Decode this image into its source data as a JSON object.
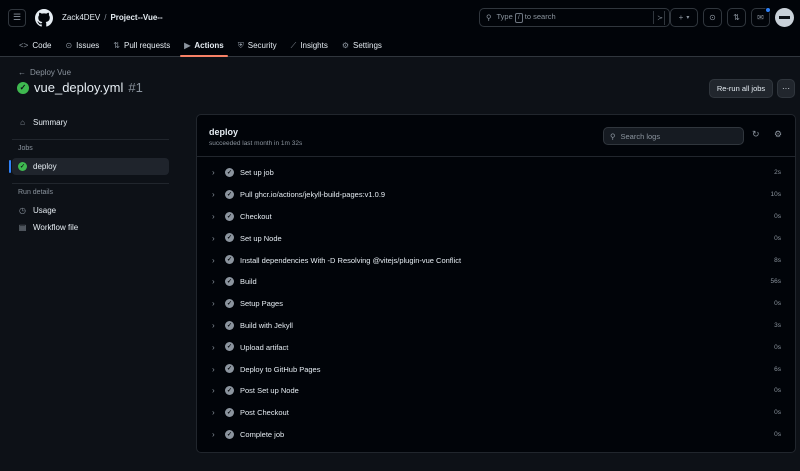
{
  "header": {
    "owner": "Zack4DEV",
    "separator": "/",
    "repo": "Project--Vue--",
    "search_pre": "Type",
    "search_key": "/",
    "search_post": "to search",
    "cmd_icon": "command-palette-icon"
  },
  "repo_nav": [
    {
      "label": "Code",
      "icon": "<>"
    },
    {
      "label": "Issues",
      "icon": "⊙"
    },
    {
      "label": "Pull requests",
      "icon": "⇅"
    },
    {
      "label": "Actions",
      "icon": "▶"
    },
    {
      "label": "Security",
      "icon": "⛨"
    },
    {
      "label": "Insights",
      "icon": "⟋"
    },
    {
      "label": "Settings",
      "icon": "⚙"
    }
  ],
  "run": {
    "back_label": "Deploy Vue",
    "title": "vue_deploy.yml",
    "number": "#1",
    "rerun_label": "Re-run all jobs",
    "more_label": "···"
  },
  "sidebar": {
    "summary": "Summary",
    "jobs_heading": "Jobs",
    "job": "deploy",
    "run_details_heading": "Run details",
    "usage": "Usage",
    "workflow_file": "Workflow file"
  },
  "job": {
    "name": "deploy",
    "status": "succeeded last month in 1m 32s",
    "search_placeholder": "Search logs"
  },
  "steps": [
    {
      "name": "Set up job",
      "duration": "2s"
    },
    {
      "name": "Pull ghcr.io/actions/jekyll-build-pages:v1.0.9",
      "duration": "10s"
    },
    {
      "name": "Checkout",
      "duration": "0s"
    },
    {
      "name": "Set up Node",
      "duration": "0s"
    },
    {
      "name": "Install dependencies With -D Resolving @vitejs/plugin-vue Conflict",
      "duration": "8s"
    },
    {
      "name": "Build",
      "duration": "56s"
    },
    {
      "name": "Setup Pages",
      "duration": "0s"
    },
    {
      "name": "Build with Jekyll",
      "duration": "3s"
    },
    {
      "name": "Upload artifact",
      "duration": "0s"
    },
    {
      "name": "Deploy to GitHub Pages",
      "duration": "6s"
    },
    {
      "name": "Post Set up Node",
      "duration": "0s"
    },
    {
      "name": "Post Checkout",
      "duration": "0s"
    },
    {
      "name": "Complete job",
      "duration": "0s"
    }
  ],
  "colors": {
    "success": "#3fb950",
    "accent_underline": "#f78166",
    "active_indicator": "#2f81f7"
  }
}
